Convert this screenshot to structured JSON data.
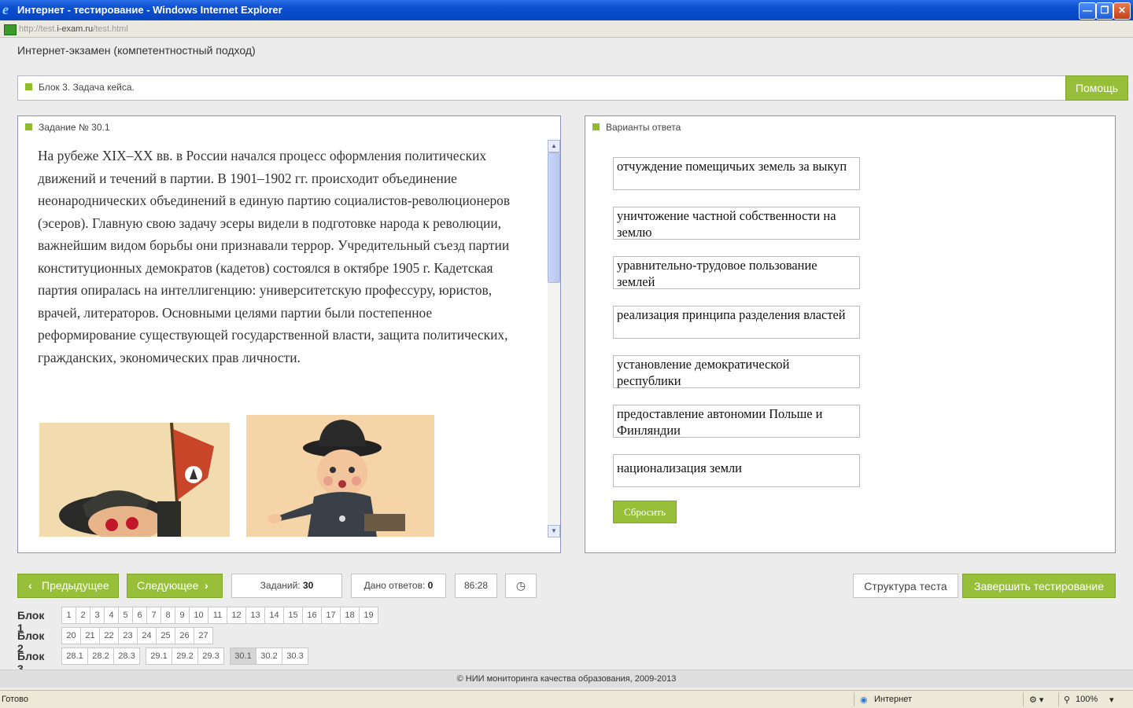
{
  "window": {
    "title": "Интернет - тестирование - Windows Internet Explorer",
    "url_prefix": "http://test.",
    "url_host": "i-exam.ru",
    "url_path": "/test.html"
  },
  "app": {
    "title": "Интернет-экзамен (компетентностный подход)",
    "block_label": "Блок 3. Задача кейса.",
    "help_label": "Помощь"
  },
  "task": {
    "title": "Задание № 30.1",
    "text": "На рубеже XIX–XX вв. в России начался процесс оформления политических движений и течений в партии. В 1901–1902 гг. происходит объединение неонароднических объединений в единую партию социалистов-революционеров (эсеров). Главную свою задачу эсеры видели в подготовке народа к революции, важнейшим видом борьбы они признавали террор. Учредительный съезд партии конституционных демократов (кадетов) состоялся в октябре 1905 г. Кадетская партия опиралась на интеллигенцию: университетскую профессуру, юристов, врачей, литераторов. Основными целями партии были постепенное реформирование существующей государственной власти, защита политических, гражданских, экономических прав личности."
  },
  "answers": {
    "title": "Варианты ответа",
    "options": [
      "отчуждение помещичьих земель за выкуп",
      "уничтожение частной собственности на землю",
      "уравнительно-трудовое пользование землей",
      "реализация принципа разделения властей",
      "установление демократической республики",
      "предоставление автономии Польше и Финляндии",
      "национализация земли"
    ],
    "reset_label": "Сбросить"
  },
  "nav": {
    "prev_label": "Предыдущее",
    "next_label": "Следующее",
    "tasks_label": "Заданий:",
    "tasks_count": "30",
    "answered_label": "Дано ответов:",
    "answered_count": "0",
    "timer": "86:28",
    "structure_label": "Структура теста",
    "finish_label": "Завершить тестирование"
  },
  "blocks": [
    {
      "label": "Блок 1",
      "groups": [
        [
          "1",
          "2",
          "3",
          "4",
          "5",
          "6",
          "7",
          "8",
          "9",
          "10",
          "11",
          "12",
          "13",
          "14",
          "15",
          "16",
          "17",
          "18",
          "19"
        ]
      ]
    },
    {
      "label": "Блок 2",
      "groups": [
        [
          "20",
          "21",
          "22",
          "23",
          "24",
          "25",
          "26",
          "27"
        ]
      ]
    },
    {
      "label": "Блок 3",
      "groups": [
        [
          "28.1",
          "28.2",
          "28.3"
        ],
        [
          "29.1",
          "29.2",
          "29.3"
        ],
        [
          "30.1",
          "30.2",
          "30.3"
        ]
      ]
    }
  ],
  "active_task": "30.1",
  "footer": "© НИИ мониторинга качества образования, 2009-2013",
  "statusbar": {
    "status": "Готово",
    "zone": "Интернет",
    "zoom": "100%"
  },
  "colors": {
    "accent_green": "#97bf3a",
    "title_bar_blue": "#0a4fd0"
  }
}
